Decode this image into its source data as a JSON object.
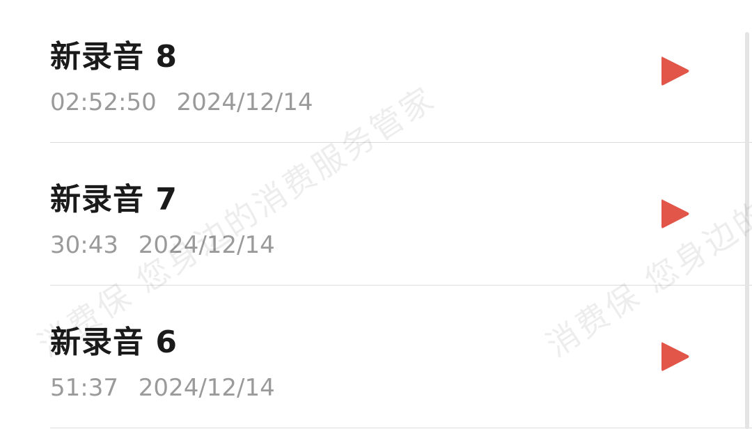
{
  "recordings": [
    {
      "title": "新录音 8",
      "duration": "02:52:50",
      "date": "2024/12/14"
    },
    {
      "title": "新录音 7",
      "duration": "30:43",
      "date": "2024/12/14"
    },
    {
      "title": "新录音 6",
      "duration": "51:37",
      "date": "2024/12/14"
    }
  ],
  "watermark": {
    "text_a": "消费保 您身边的消费服务管家",
    "text_b": "消费保 您身边的消费服务管家"
  },
  "colors": {
    "accent": "#e2564a",
    "title": "#1a1a1a",
    "meta": "#9a9a9a"
  },
  "icons": {
    "play": "play-icon"
  }
}
